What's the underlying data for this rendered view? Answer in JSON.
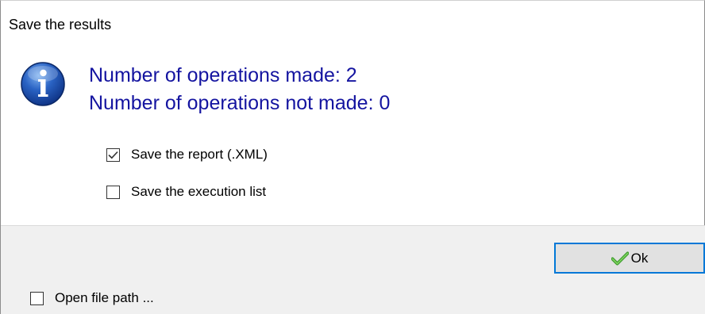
{
  "dialog": {
    "title": "Save the results"
  },
  "message": {
    "icon": "info-icon",
    "line1": "Number of operations made: 2",
    "line2": "Number of operations not made: 0",
    "color": "#1414a0"
  },
  "options": [
    {
      "label": "Save the report (.XML)",
      "checked": true
    },
    {
      "label": "Save the execution list",
      "checked": false
    }
  ],
  "footer": {
    "ok_label": "Ok",
    "ok_icon": "check-icon",
    "open_path_label": "Open file path ...",
    "open_path_checked": false
  }
}
